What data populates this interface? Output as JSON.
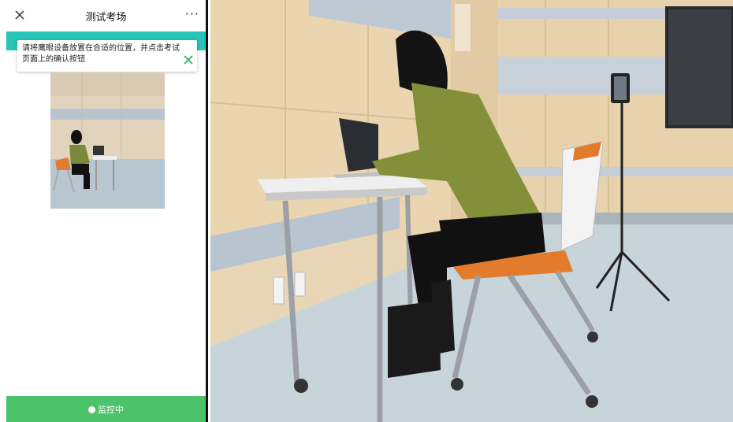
{
  "navbar": {
    "title": "测试考场",
    "more_label": "···",
    "close_icon": "close-icon"
  },
  "tip": {
    "text": "请将鹰眼设备放置在合适的位置，并点击考试页面上的确认按钮",
    "close_icon": "check-close-icon"
  },
  "bottom_bar": {
    "label": "监控中"
  },
  "colors": {
    "teal_bar": "#27c4b7",
    "bottom_bar": "#4cc26a",
    "tip_close": "#2fb36a"
  }
}
